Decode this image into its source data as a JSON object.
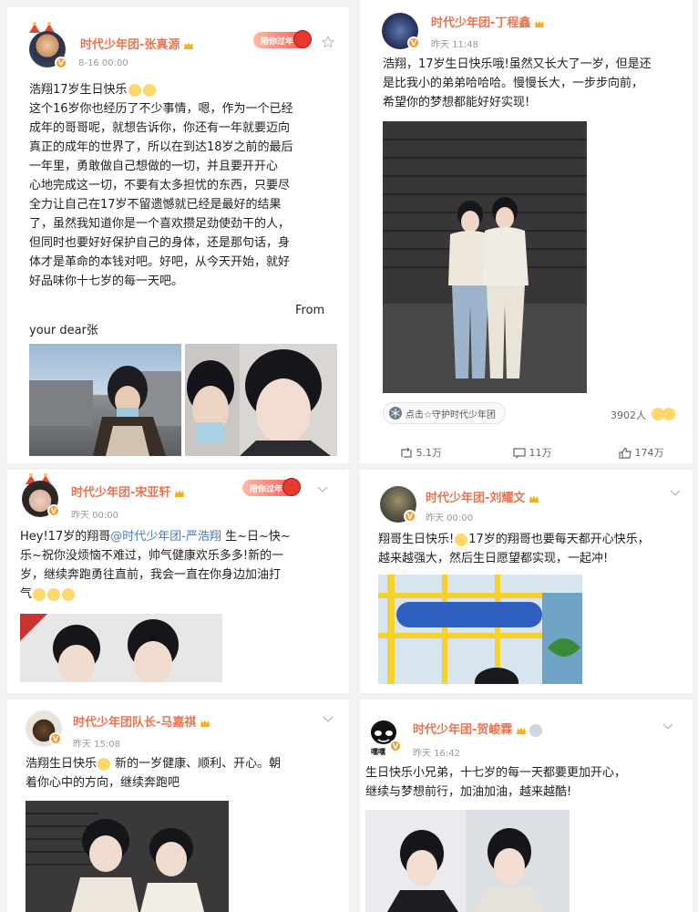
{
  "posts": [
    {
      "username": "时代少年团-张真源",
      "time": "8-16 00:00",
      "badge_label": "陪你过年",
      "lines": [
        "浩翔17岁生日快乐",
        "这个16岁你也经历了不少事情，嗯，作为一个已经",
        "成年的哥哥呢，就想告诉你，你还有一年就要迈向",
        "真正的成年的世界了，所以在到达18岁之前的最后",
        "一年里，勇敢做自己想做的一切，并且要开开心",
        "心地完成这一切，不要有太多担忧的东西，只要尽",
        "全力让自己在17岁不留遗憾就已经是最好的结果",
        "了，虽然我知道你是一个喜欢攒足劲使劲干的人，",
        "但同时也要好好保护自己的身体，还是那句话，身",
        "体才是革命的本钱对吧。好吧，从今天开始，就好",
        "好品味你十七岁的每一天吧。"
      ],
      "from_label": "From",
      "signoff": "your dear张"
    },
    {
      "username": "时代少年团-丁程鑫",
      "time": "昨天 11:48",
      "lines": [
        "浩翔，17岁生日快乐哦!虽然又长大了一岁，但是还",
        "是比我小的弟弟哈哈哈。慢慢长大，一步步向前，",
        "希望你的梦想都能好好实现!"
      ],
      "topic_chip": "点击☆守护时代少年团",
      "reactions_count": "3902人",
      "reposts": "5.1万",
      "comments": "11万",
      "likes": "174万"
    },
    {
      "username": "时代少年团-宋亚轩",
      "time": "昨天 00:00",
      "badge_label": "陪你过年",
      "line1_a": "Hey!17岁的翔哥",
      "line1_mention": "@时代少年团-严浩翔",
      "line1_b": " 生~日~快~",
      "lines": [
        "乐~祝你没烦恼不难过，帅气健康欢乐多多!新的一",
        "岁，继续奔跑勇往直前，我会一直在你身边加油打",
        "气"
      ]
    },
    {
      "username": "时代少年团-刘耀文",
      "time": "昨天 00:00",
      "line1_a": "翔哥生日快乐!",
      "line1_b": "17岁的翔哥也要每天都开心快乐，",
      "lines": [
        "越来越强大，然后生日愿望都实现，一起冲!"
      ]
    },
    {
      "username": "时代少年团队长-马嘉祺",
      "time": "昨天 15:08",
      "line1_a": "浩翔生日快乐",
      "line1_b": " 新的一岁健康、顺利、开心。朝",
      "lines": [
        "着你心中的方向，继续奔跑吧"
      ]
    },
    {
      "username": "时代少年团-贺峻霖",
      "time": "昨天 16:42",
      "avatar_caption": "嘿嘿",
      "lines": [
        "生日快乐小兄弟，十七岁的每一天都要更加开心，",
        "继续与梦想前行，加油加油，越来越酷!"
      ]
    }
  ],
  "colors": {
    "username": "#eb7350",
    "mention": "#4a7ab8",
    "verified": "#f79b2c",
    "text": "#222222",
    "meta": "#999999"
  }
}
